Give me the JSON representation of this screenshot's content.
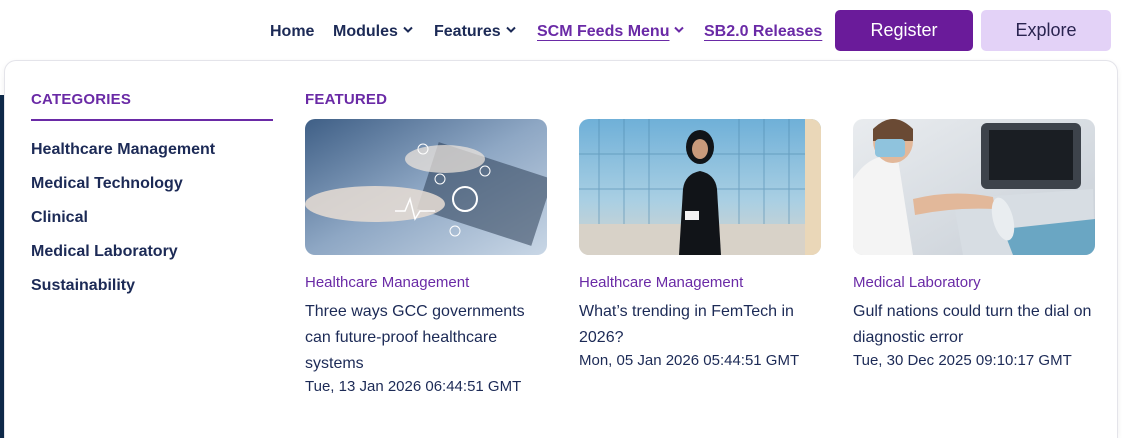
{
  "nav": {
    "home": "Home",
    "modules": "Modules",
    "features": "Features",
    "scm_feeds_menu": "SCM Feeds Menu",
    "sb_releases": "SB2.0 Releases",
    "register": "Register",
    "explore": "Explore"
  },
  "categories": {
    "heading": "CATEGORIES",
    "items": [
      "Healthcare Management",
      "Medical Technology",
      "Clinical",
      "Medical Laboratory",
      "Sustainability"
    ]
  },
  "featured": {
    "heading": "FEATURED",
    "cards": [
      {
        "category": "Healthcare Management",
        "title": "Three ways GCC governments can future-proof healthcare systems",
        "date": "Tue, 13 Jan 2026 06:44:51 GMT"
      },
      {
        "category": "Healthcare Management",
        "title": "What’s trending in FemTech in 2026?",
        "date": "Mon, 05 Jan 2026 05:44:51 GMT"
      },
      {
        "category": "Medical Laboratory",
        "title": "Gulf nations could turn the dial on diagnostic error",
        "date": "Tue, 30 Dec 2025 09:10:17 GMT"
      }
    ]
  },
  "colors": {
    "brand_purple": "#6a1b9a",
    "link_purple": "#6a2aa6",
    "explore_bg": "#e3d2f7",
    "text_navy": "#1c2a56"
  }
}
